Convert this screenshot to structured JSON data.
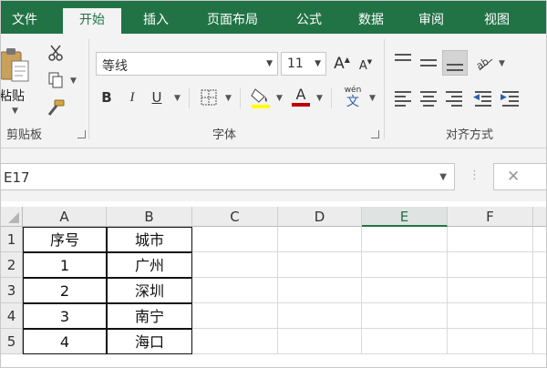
{
  "tabs": [
    "文件",
    "开始",
    "插入",
    "页面布局",
    "公式",
    "数据",
    "审阅",
    "视图"
  ],
  "active_tab": "开始",
  "clipboard": {
    "paste_label": "粘贴",
    "group_label": "剪贴板"
  },
  "font": {
    "name": "等线",
    "size": "11",
    "bold": "B",
    "italic": "I",
    "underline": "U",
    "grow": "A",
    "shrink": "A",
    "font_color_letter": "A",
    "phonetic_top": "wén",
    "phonetic_bottom": "文",
    "group_label": "字体",
    "fill_color": "#ffff00",
    "font_color": "#c00000"
  },
  "alignment": {
    "group_label": "对齐方式"
  },
  "name_box": "E17",
  "formula_cancel": "✕",
  "columns": [
    "A",
    "B",
    "C",
    "D",
    "E",
    "F"
  ],
  "selected_column": "E",
  "rows": [
    {
      "num": "1",
      "A": "序号",
      "B": "城市"
    },
    {
      "num": "2",
      "A": "1",
      "B": "广州"
    },
    {
      "num": "3",
      "A": "2",
      "B": "深圳"
    },
    {
      "num": "4",
      "A": "3",
      "B": "南宁"
    },
    {
      "num": "5",
      "A": "4",
      "B": "海口"
    }
  ],
  "colors": {
    "brand": "#217346",
    "ribbon": "#f3f3f3"
  }
}
